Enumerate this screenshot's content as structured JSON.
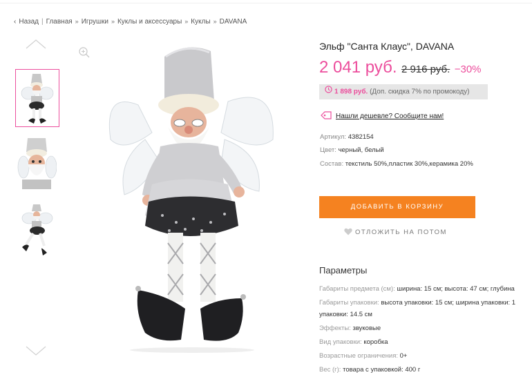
{
  "breadcrumb": {
    "back": "Назад",
    "items": [
      "Главная",
      "Игрушки",
      "Куклы и аксессуары",
      "Куклы",
      "DAVANA"
    ]
  },
  "gallery": {
    "thumbnails": [
      "Эльф Санта Клаус - вид 1",
      "Эльф Санта Клаус - вид 2",
      "Эльф Санта Клаус - вид 3"
    ],
    "active_index": 0
  },
  "product": {
    "title": "Эльф \"Санта Клаус\", DAVANA",
    "price": "2 041 руб.",
    "old_price": "2 916 руб.",
    "discount": "−30%",
    "promo_price": "1 898 руб.",
    "promo_note": "(Доп. скидка 7% по промокоду)",
    "cheaper_link": "Нашли дешевле? Сообщите нам!",
    "attributes": [
      {
        "label": "Артикул:",
        "value": "4382154"
      },
      {
        "label": "Цвет:",
        "value": "черный, белый"
      },
      {
        "label": "Состав:",
        "value": "текстиль 50%,пластик 30%,керамика 20%"
      }
    ],
    "add_to_cart": "ДОБАВИТЬ В КОРЗИНУ",
    "save_later": "ОТЛОЖИТЬ НА ПОТОМ"
  },
  "parameters": {
    "title": "Параметры",
    "rows": [
      {
        "label": "Габариты предмета (см):",
        "value": "ширина: 15 см; высота: 47 см; глубина"
      },
      {
        "label": "Габариты упаковки:",
        "value": "высота упаковки: 15 см; ширина упаковки: 1"
      },
      {
        "label": "",
        "value": "упаковки: 14.5 см"
      },
      {
        "label": "Эффекты:",
        "value": "звуковые"
      },
      {
        "label": "Вид упаковки:",
        "value": "коробка"
      },
      {
        "label": "Возрастные ограничения:",
        "value": "0+"
      },
      {
        "label": "Вес (г):",
        "value": "товара с упаковкой: 400 г"
      }
    ]
  },
  "colors": {
    "accent_pink": "#ec4d9c",
    "button_orange": "#f58220",
    "promo_bg": "#e6e6e6"
  }
}
